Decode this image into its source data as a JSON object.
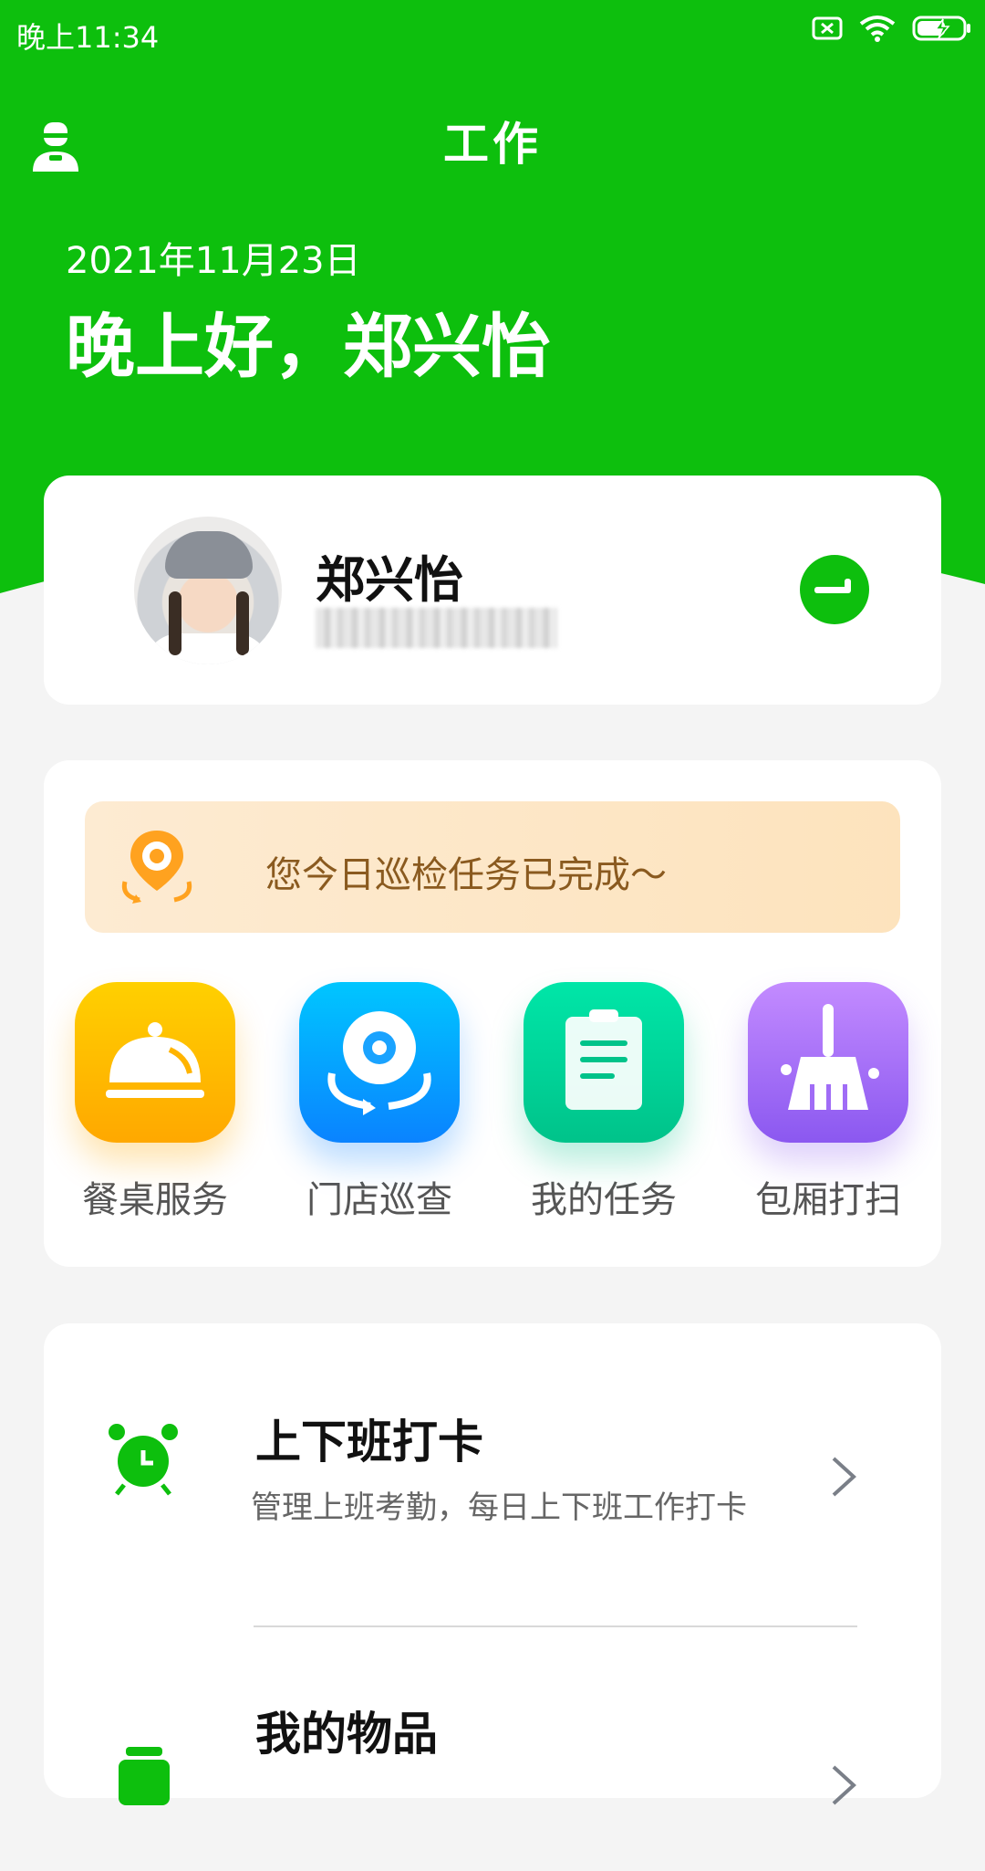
{
  "status_bar": {
    "time": "晚上11:34"
  },
  "header": {
    "title": "工作",
    "date": "2021年11月23日",
    "greeting": "晚上好，郑兴怡"
  },
  "profile": {
    "name": "郑兴怡"
  },
  "notice": {
    "text": "您今日巡检任务已完成～"
  },
  "tools": [
    {
      "label": "餐桌服务",
      "icon": "service-bell-icon",
      "color": "#ffb400"
    },
    {
      "label": "门店巡查",
      "icon": "location-rotate-icon",
      "color": "#0a9bff"
    },
    {
      "label": "我的任务",
      "icon": "clipboard-icon",
      "color": "#00d39b"
    },
    {
      "label": "包厢打扫",
      "icon": "broom-icon",
      "color": "#a06cf6"
    }
  ],
  "menu": [
    {
      "title": "上下班打卡",
      "desc": "管理上班考勤，每日上下班工作打卡",
      "icon": "alarm-clock-icon"
    },
    {
      "title": "我的物品",
      "icon": "items-icon"
    }
  ],
  "colors": {
    "accent": "#0dbf0d",
    "background": "#f4f4f4"
  }
}
